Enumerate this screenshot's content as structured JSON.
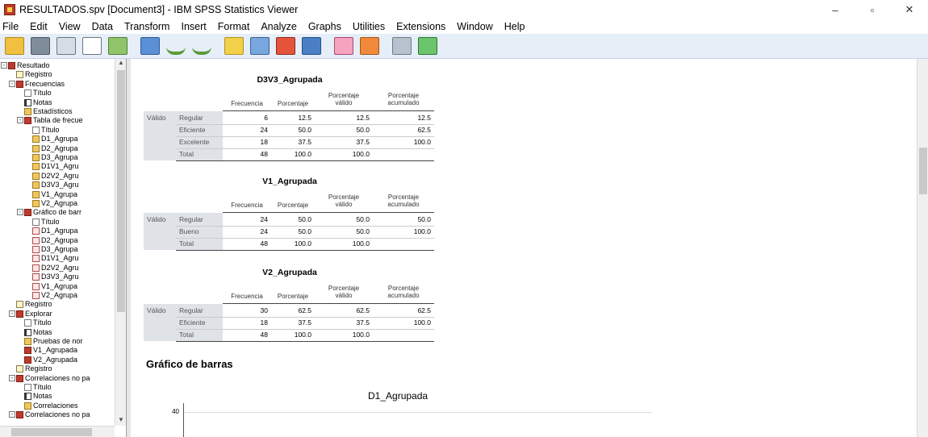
{
  "window": {
    "title": "RESULTADOS.spv [Document3] - IBM SPSS Statistics Viewer",
    "controls": [
      "–",
      "▫",
      "✕"
    ]
  },
  "menu": [
    "File",
    "Edit",
    "View",
    "Data",
    "Transform",
    "Insert",
    "Format",
    "Analyze",
    "Graphs",
    "Utilities",
    "Extensions",
    "Window",
    "Help"
  ],
  "toolbar": {
    "buttons": [
      "open-folder-icon",
      "save-icon",
      "print-icon",
      "print-preview-icon",
      "export-icon",
      "recall-dialog-icon",
      "undo-icon",
      "redo-icon",
      "goto-data-icon",
      "goto-case-icon",
      "goto-variable-icon",
      "variables-icon",
      "show-all-icon",
      "designate-window-icon",
      "insert-output-icon",
      "hide-icon",
      "promote-icon"
    ]
  },
  "tree": {
    "nodes": [
      {
        "label": "Resultado",
        "icon": "book"
      },
      {
        "label": "Registro",
        "icon": "log"
      },
      {
        "label": "Frecuencias",
        "icon": "book"
      },
      {
        "label": "Título",
        "icon": "title"
      },
      {
        "label": "Notas",
        "icon": "notes"
      },
      {
        "label": "Estadísticos",
        "icon": "table"
      },
      {
        "label": "Tabla de frecue",
        "icon": "book"
      },
      {
        "label": "Título",
        "icon": "title"
      },
      {
        "label": "D1_Agrupa",
        "icon": "table"
      },
      {
        "label": "D2_Agrupa",
        "icon": "table"
      },
      {
        "label": "D3_Agrupa",
        "icon": "table"
      },
      {
        "label": "D1V1_Agru",
        "icon": "table"
      },
      {
        "label": "D2V2_Agru",
        "icon": "table"
      },
      {
        "label": "D3V3_Agru",
        "icon": "table"
      },
      {
        "label": "V1_Agrupa",
        "icon": "table"
      },
      {
        "label": "V2_Agrupa",
        "icon": "table"
      },
      {
        "label": "Gráfico de barr",
        "icon": "book"
      },
      {
        "label": "Título",
        "icon": "title"
      },
      {
        "label": "D1_Agrupa",
        "icon": "chart"
      },
      {
        "label": "D2_Agrupa",
        "icon": "chart"
      },
      {
        "label": "D3_Agrupa",
        "icon": "chart"
      },
      {
        "label": "D1V1_Agru",
        "icon": "chart"
      },
      {
        "label": "D2V2_Agru",
        "icon": "chart"
      },
      {
        "label": "D3V3_Agru",
        "icon": "chart"
      },
      {
        "label": "V1_Agrupa",
        "icon": "chart"
      },
      {
        "label": "V2_Agrupa",
        "icon": "chart"
      },
      {
        "label": "Registro",
        "icon": "log"
      },
      {
        "label": "Explorar",
        "icon": "book"
      },
      {
        "label": "Título",
        "icon": "title"
      },
      {
        "label": "Notas",
        "icon": "notes"
      },
      {
        "label": "Pruebas de nor",
        "icon": "table"
      },
      {
        "label": "V1_Agrupada",
        "icon": "book"
      },
      {
        "label": "V2_Agrupada",
        "icon": "book"
      },
      {
        "label": "Registro",
        "icon": "log"
      },
      {
        "label": "Correlaciones no pa",
        "icon": "book"
      },
      {
        "label": "Título",
        "icon": "title"
      },
      {
        "label": "Notas",
        "icon": "notes"
      },
      {
        "label": "Correlaciones",
        "icon": "table"
      },
      {
        "label": "Correlaciones no pa",
        "icon": "book"
      }
    ]
  },
  "table_headers": {
    "frecuencia": "Frecuencia",
    "porcentaje": "Porcentaje",
    "porcentaje_valido_1": "Porcentaje",
    "porcentaje_valido_2": "válido",
    "porcentaje_acum_1": "Porcentaje",
    "porcentaje_acum_2": "acumulado",
    "valido": "Válido"
  },
  "tables": [
    {
      "title": "D3V3_Agrupada",
      "rows": [
        {
          "label": "Regular",
          "freq": "6",
          "pct": "12.5",
          "valid": "12.5",
          "cum": "12.5"
        },
        {
          "label": "Eficiente",
          "freq": "24",
          "pct": "50.0",
          "valid": "50.0",
          "cum": "62.5"
        },
        {
          "label": "Excelente",
          "freq": "18",
          "pct": "37.5",
          "valid": "37.5",
          "cum": "100.0"
        },
        {
          "label": "Total",
          "freq": "48",
          "pct": "100.0",
          "valid": "100.0",
          "cum": ""
        }
      ]
    },
    {
      "title": "V1_Agrupada",
      "rows": [
        {
          "label": "Regular",
          "freq": "24",
          "pct": "50.0",
          "valid": "50.0",
          "cum": "50.0"
        },
        {
          "label": "Bueno",
          "freq": "24",
          "pct": "50.0",
          "valid": "50.0",
          "cum": "100.0"
        },
        {
          "label": "Total",
          "freq": "48",
          "pct": "100.0",
          "valid": "100.0",
          "cum": ""
        }
      ]
    },
    {
      "title": "V2_Agrupada",
      "rows": [
        {
          "label": "Regular",
          "freq": "30",
          "pct": "62.5",
          "valid": "62.5",
          "cum": "62.5"
        },
        {
          "label": "Eficiente",
          "freq": "18",
          "pct": "37.5",
          "valid": "37.5",
          "cum": "100.0"
        },
        {
          "label": "Total",
          "freq": "48",
          "pct": "100.0",
          "valid": "100.0",
          "cum": ""
        }
      ]
    }
  ],
  "section": {
    "title": "Gráfico de barras"
  },
  "chart": {
    "title": "D1_Agrupada",
    "tick_40": "40"
  },
  "colors": {
    "toolbar_bg": "#e6eef8",
    "table_shade": "#dfe3e8",
    "book_icon": "#c0392b"
  }
}
